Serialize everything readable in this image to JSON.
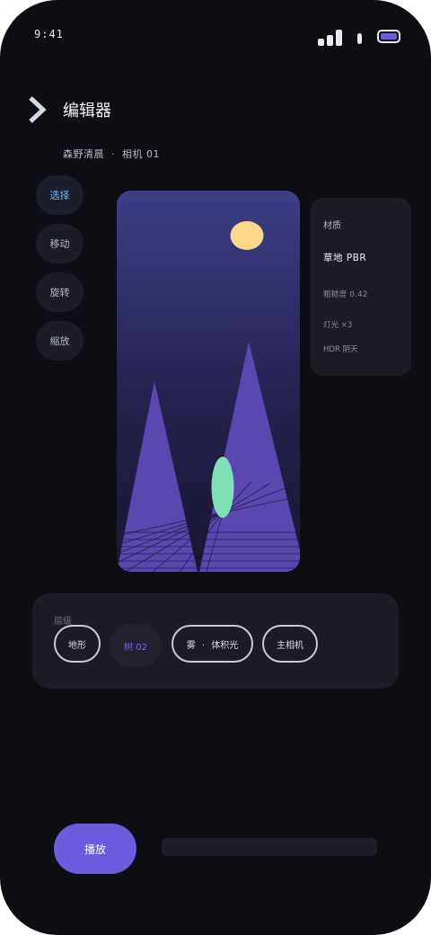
{
  "status_bar": {
    "time": "9:41"
  },
  "header": {
    "title": "编辑器",
    "back_icon": "chevron-right-icon"
  },
  "breadcrumb": {
    "scene": "森野清晨",
    "separator": "·",
    "camera": "相机 01"
  },
  "tools": [
    {
      "label": "选择",
      "active": true
    },
    {
      "label": "移动",
      "active": false
    },
    {
      "label": "旋转",
      "active": false
    },
    {
      "label": "缩放",
      "active": false
    }
  ],
  "properties": {
    "title": "材质",
    "material": "草地 PBR",
    "roughness": "粗糙度 0.42",
    "light": "灯光 ×3",
    "hdr": "HDR 阴天"
  },
  "layers": {
    "label": "层级",
    "chips": [
      {
        "label": "地形",
        "selected": false
      },
      {
        "label": "树 02",
        "selected": true
      },
      {
        "label": "雾 · 体积光",
        "selected": false
      },
      {
        "label": "主相机",
        "selected": false
      }
    ]
  },
  "playback": {
    "play_label": "播放"
  },
  "colors": {
    "background": "#0d0e13",
    "accent": "#6b5ce0",
    "active_tool": "#72b6ec",
    "sky_top": "#3d3d86",
    "mountain": "#5a48b0",
    "moon": "#fcd88b",
    "tree": "#7fe0b8"
  }
}
